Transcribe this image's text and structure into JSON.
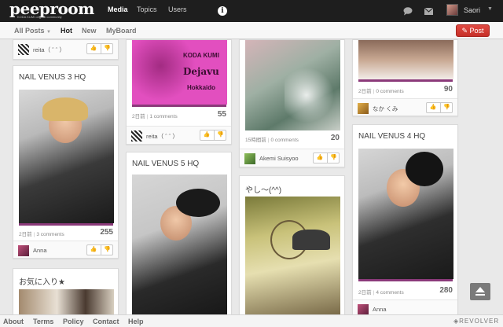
{
  "nav": {
    "logo": "peeproom",
    "logo_sub": "KODA KUMI original community",
    "links": [
      "Media",
      "Topics",
      "Users"
    ],
    "user_name": "Saori",
    "post_label": "Post"
  },
  "tabs": [
    "All Posts",
    "Hot",
    "New",
    "MyBoard"
  ],
  "cards": [
    {
      "title": "",
      "posted": "",
      "comments": "",
      "score": "",
      "user": "reita（ ˆ ˆ ）"
    },
    {
      "title": "NAIL VENUS 3 HQ",
      "posted": "2日前",
      "comments": "3 comments",
      "score": "255",
      "user": "Anna"
    },
    {
      "title": "お気に入り★",
      "posted": "",
      "comments": "",
      "score": "",
      "user": ""
    },
    {
      "title": "",
      "posted": "2日前",
      "comments": "1 comments",
      "score": "55",
      "user": "reita（ ˆ ˆ ）",
      "img_text": [
        "KODA KUMI",
        "Dejavu",
        "Hokkaido"
      ]
    },
    {
      "title": "NAIL VENUS 5 HQ",
      "posted": "",
      "comments": "",
      "score": "",
      "user": ""
    },
    {
      "title": "",
      "posted": "15時間前",
      "comments": "0 comments",
      "score": "20",
      "user": "Akemi Suisyoo"
    },
    {
      "title": "やし〜(^^)",
      "posted": "",
      "comments": "",
      "score": "",
      "user": ""
    },
    {
      "title": "",
      "posted": "2日前",
      "comments": "0 comments",
      "score": "90",
      "user": "なか くみ"
    },
    {
      "title": "NAIL VENUS 4 HQ",
      "posted": "2日前",
      "comments": "4 comments",
      "score": "280",
      "user": "Anna"
    }
  ],
  "footer": {
    "links": [
      "About",
      "Terms",
      "Policy",
      "Contact",
      "Help"
    ],
    "brand": "REVOLVER"
  }
}
